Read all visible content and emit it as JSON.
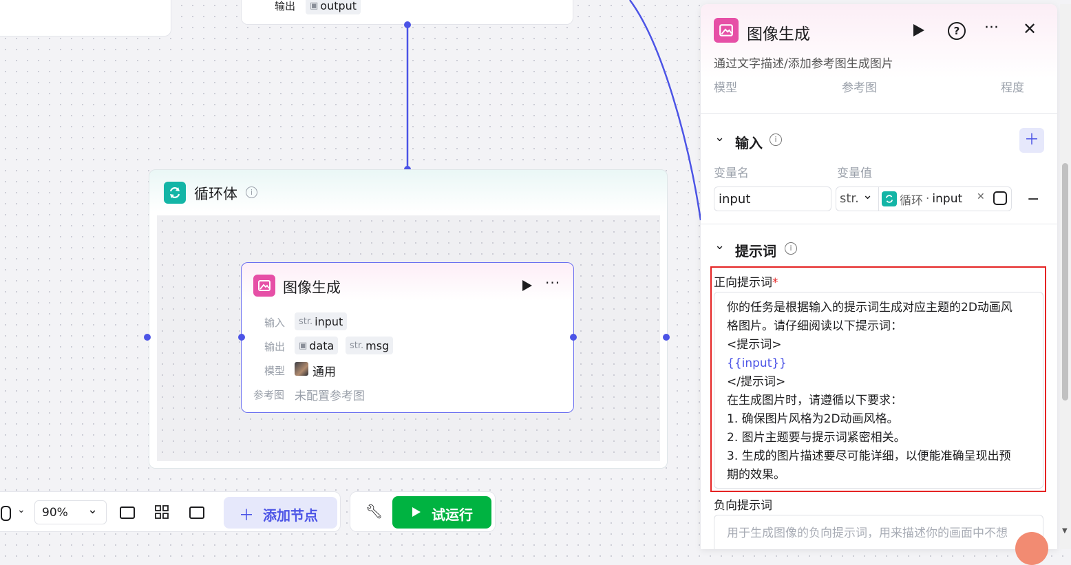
{
  "canvas": {
    "top_node": {
      "output_label": "输出",
      "output_tag": "output"
    },
    "loop": {
      "title": "循环体"
    },
    "image_node": {
      "title": "图像生成",
      "input_label": "输入",
      "input_type": "str.",
      "input_name": "input",
      "output_label": "输出",
      "output_data": "data",
      "output_msg_type": "str.",
      "output_msg": "msg",
      "model_label": "模型",
      "model_value": "通用",
      "ref_label": "参考图",
      "ref_value": "未配置参考图"
    }
  },
  "toolbar": {
    "zoom": "90%",
    "add_node": "添加节点",
    "run": "试运行"
  },
  "panel": {
    "title": "图像生成",
    "description": "通过文字描述/添加参考图生成图片",
    "cols": {
      "model": "模型",
      "ref": "参考图",
      "degree": "程度"
    },
    "input_section": {
      "title": "输入",
      "var_name_header": "变量名",
      "var_value_header": "变量值",
      "var_name": "input",
      "var_type": "str.",
      "ref_loop": "循环",
      "ref_sep": "·",
      "ref_var": "input"
    },
    "prompt_section": {
      "title": "提示词",
      "positive_label": "正向提示词",
      "required_mark": "*",
      "positive_lines": [
        "你的任务是根据输入的提示词生成对应主题的2D动画风",
        "格图片。请仔细阅读以下提示词：",
        "<提示词>",
        "{{input}}",
        "</提示词>",
        "在生成图片时，请遵循以下要求：",
        "1. 确保图片风格为2D动画风格。",
        "2. 图片主题要与提示词紧密相关。",
        "3. 生成的图片描述要尽可能详细，以便能准确呈现出预",
        "期的效果。"
      ],
      "negative_label": "负向提示词",
      "negative_placeholder": "用于生成图像的负向提示词，用来描述你的画面中不想"
    }
  },
  "colors": {
    "accent": "#4c54e6",
    "image_icon": "#e64fa6",
    "loop_icon": "#13b5a6",
    "run_green": "#00b341",
    "highlight_red": "#e52323"
  }
}
